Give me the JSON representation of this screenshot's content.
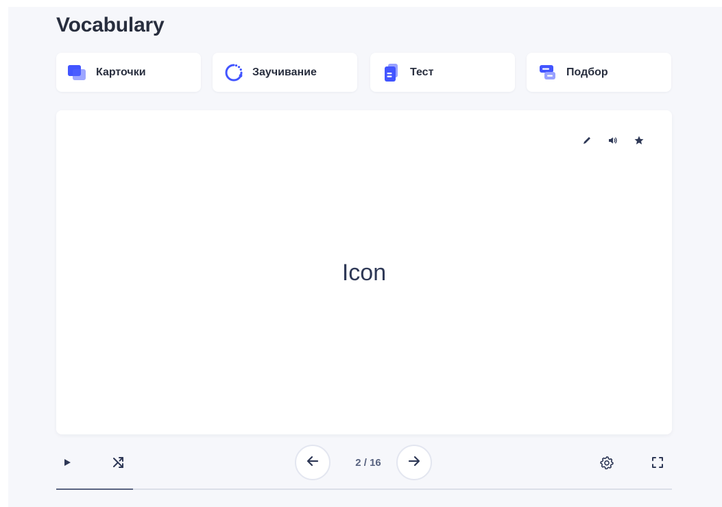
{
  "page": {
    "title": "Vocabulary"
  },
  "modes": [
    {
      "label": "Карточки",
      "icon": "cards-icon"
    },
    {
      "label": "Заучивание",
      "icon": "learn-cycle-icon"
    },
    {
      "label": "Тест",
      "icon": "test-document-icon"
    },
    {
      "label": "Подбор",
      "icon": "match-icon"
    }
  ],
  "card": {
    "term": "Icon",
    "actions": [
      "edit-icon",
      "audio-icon",
      "star-icon"
    ]
  },
  "controls": {
    "counter": "2 / 16",
    "progress_fraction": 0.125
  },
  "colors": {
    "accent": "#4255ff",
    "background": "#f6f7fb",
    "text": "#282e3e",
    "muted": "#586380"
  }
}
